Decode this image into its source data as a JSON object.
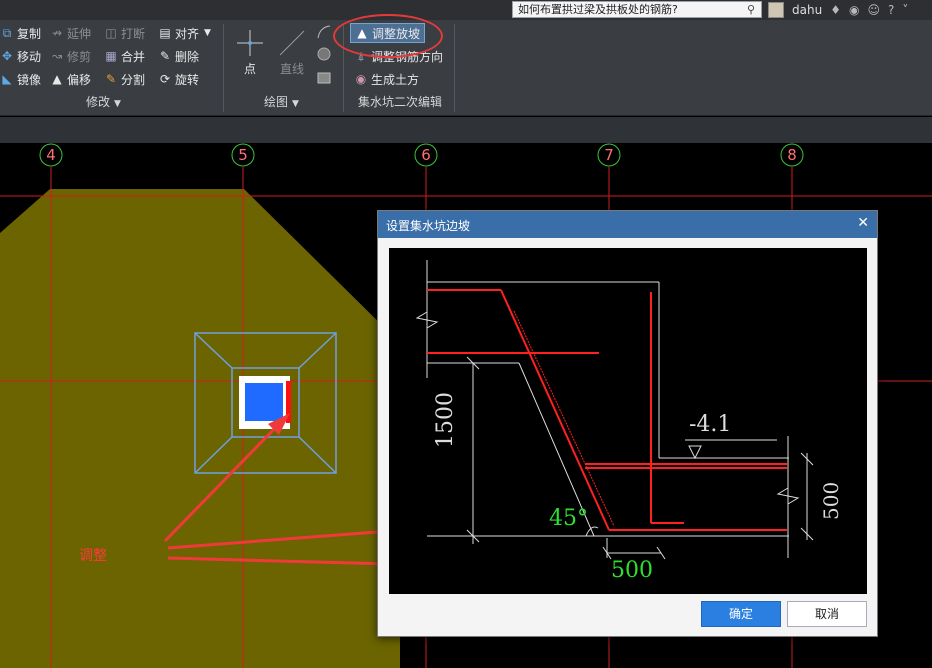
{
  "topbar": {
    "search_placeholder": "如何布置拱过梁及拱板处的钢筋?",
    "username": "dahu"
  },
  "ribbon": {
    "modify": {
      "copy": "复制",
      "extend": "延伸",
      "break": "打断",
      "align": "对齐",
      "move": "移动",
      "trim": "修剪",
      "merge": "合并",
      "delete": "删除",
      "mirror": "镜像",
      "offset": "偏移",
      "split": "分割",
      "rotate": "旋转",
      "title": "修改"
    },
    "draw": {
      "point": "点",
      "line": "直线",
      "title": "绘图"
    },
    "pit": {
      "adjust_slope": "调整放坡",
      "adjust_rebar": "调整钢筋方向",
      "generate_earth": "生成土方",
      "title": "集水坑二次编辑"
    }
  },
  "canvas": {
    "axis_labels": [
      "4",
      "5",
      "6",
      "7",
      "8"
    ],
    "annotation": "调整"
  },
  "dialog": {
    "title": "设置集水坑边坡",
    "dim_depth": "1500",
    "dim_elev": "-4.1",
    "dim_right": "500",
    "angle": "45°",
    "dim_bottom": "500",
    "ok": "确定",
    "cancel": "取消"
  }
}
